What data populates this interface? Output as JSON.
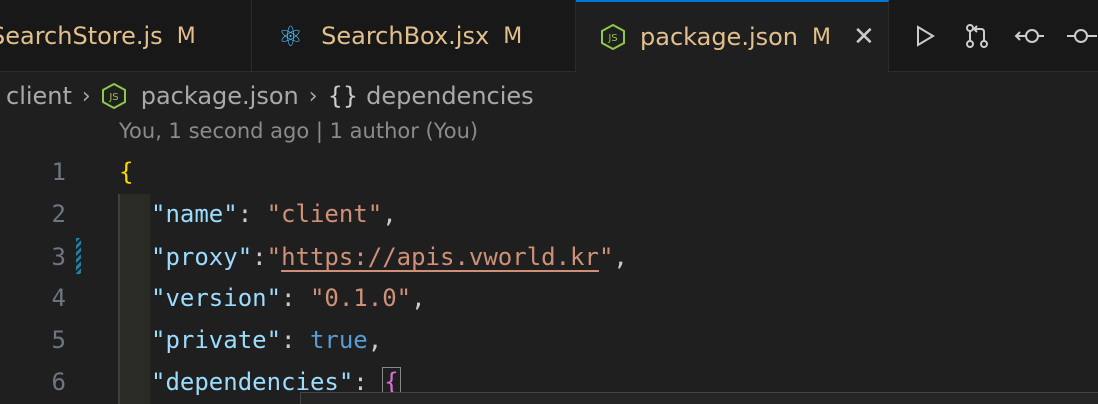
{
  "tabs": [
    {
      "name": "SearchStore.js",
      "status": "M"
    },
    {
      "name": "SearchBox.jsx",
      "status": "M"
    },
    {
      "name": "package.json",
      "status": "M",
      "close": "✕"
    }
  ],
  "breadcrumb": {
    "folder": "client",
    "file": "package.json",
    "braces": "{}",
    "symbol": "dependencies"
  },
  "blame": "You, 1 second ago | 1 author (You)",
  "lines": [
    {
      "num": "1",
      "text": "{"
    },
    {
      "num": "2",
      "key": "\"name\"",
      "sep": ": ",
      "value": "\"client\"",
      "end": ","
    },
    {
      "num": "3",
      "key": "\"proxy\"",
      "sep": ":",
      "q1": "\"",
      "url": "https://apis.vworld.kr",
      "q2": "\"",
      "end": ","
    },
    {
      "num": "4",
      "key": "\"version\"",
      "sep": ": ",
      "value": "\"0.1.0\"",
      "end": ","
    },
    {
      "num": "5",
      "key": "\"private\"",
      "sep": ": ",
      "value": "true",
      "end": ","
    },
    {
      "num": "6",
      "key": "\"dependencies\"",
      "sep": ": ",
      "value": "{"
    }
  ],
  "colors": {
    "accent": "#0078d4",
    "modified": "#e2c08d",
    "key": "#9cdcfe",
    "string": "#ce9178",
    "keyword": "#569cd6"
  },
  "icons": [
    "js-file-icon",
    "react-icon",
    "node-js-icon",
    "close-icon",
    "run-icon",
    "git-compare-icon",
    "go-back-icon",
    "go-forward-icon",
    "chevron-right-icon"
  ]
}
